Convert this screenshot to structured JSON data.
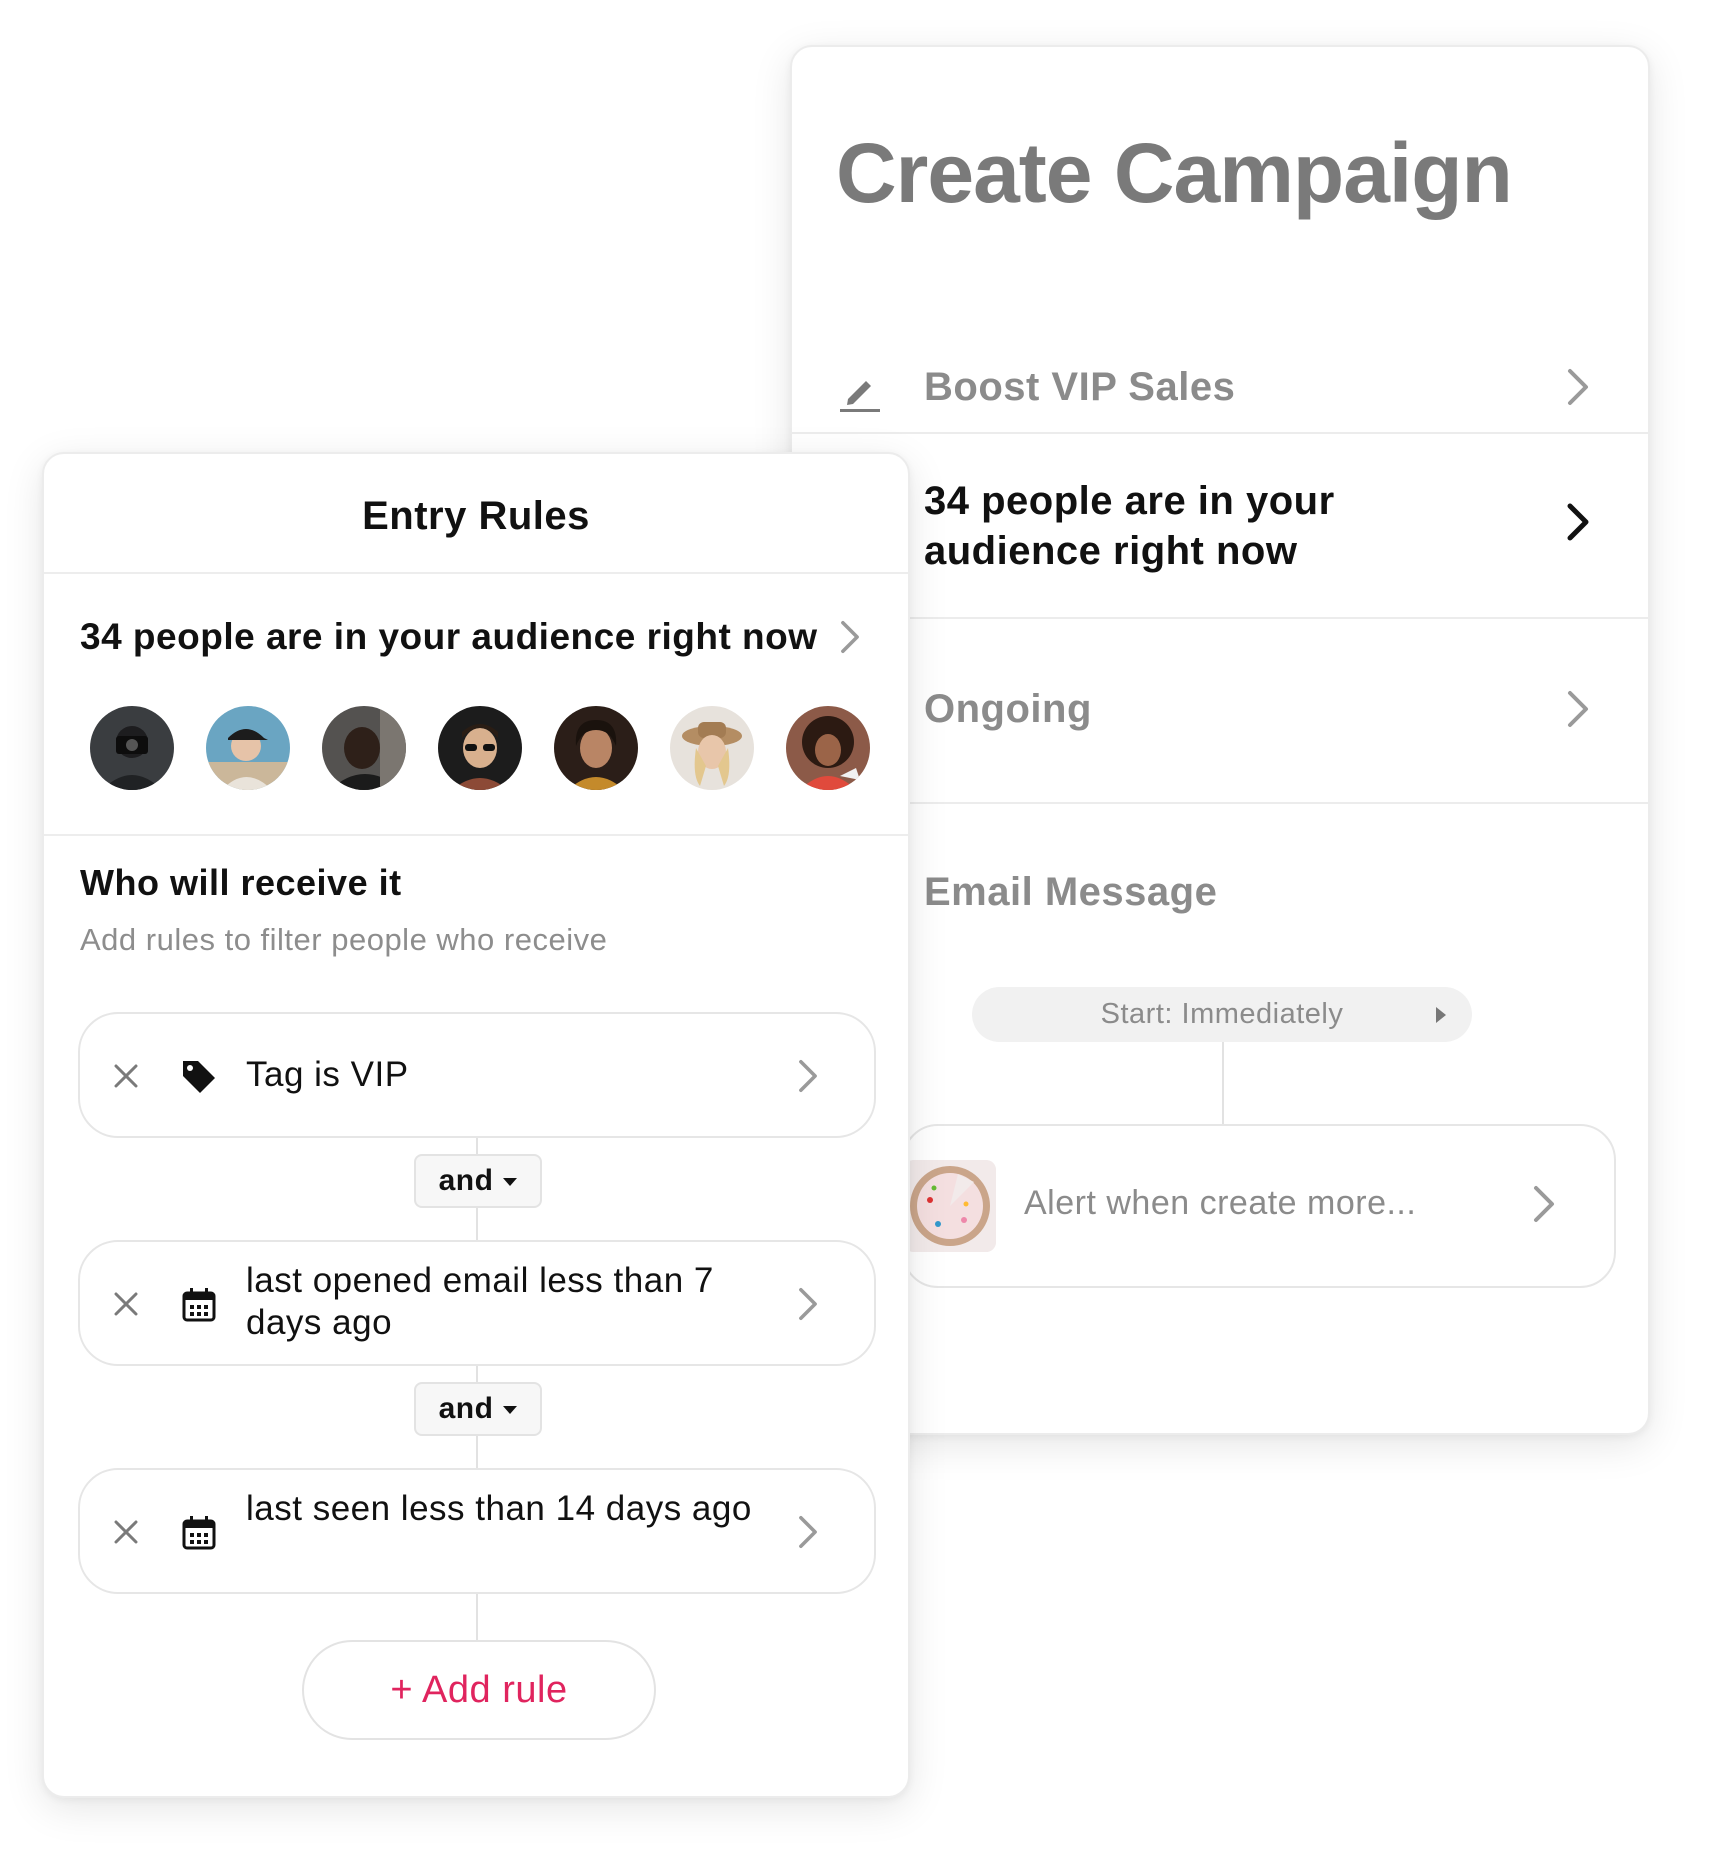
{
  "campaign": {
    "title": "Create Campaign",
    "name": "Boost VIP Sales",
    "audience": "34 people are in your audience right now",
    "schedule": "Ongoing",
    "email_section": "Email Message",
    "start_label": "Start: Immediately",
    "email_step": "Alert when create more..."
  },
  "entry_rules": {
    "title": "Entry Rules",
    "audience": "34 people are in your audience right now",
    "avatars_count": 7,
    "section_title": "Who will receive it",
    "section_subtitle": "Add rules to filter people who receive",
    "rules": [
      {
        "icon": "tag-icon",
        "label": "Tag is VIP"
      },
      {
        "icon": "calendar-icon",
        "label": "last opened email less than 7 days ago"
      },
      {
        "icon": "calendar-icon",
        "label": "last seen less than 14 days ago"
      }
    ],
    "connectors": [
      "and",
      "and"
    ],
    "add_rule": "+ Add rule"
  },
  "colors": {
    "accent": "#e0245e",
    "muted_text": "#8b8b8b",
    "border": "#e6e6e6"
  }
}
